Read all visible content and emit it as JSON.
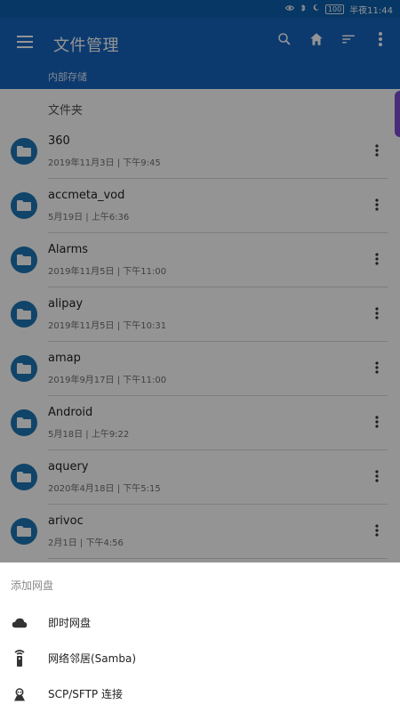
{
  "status_bar": {
    "battery": "100",
    "time": "半夜11:44",
    "icons": [
      "eye-icon",
      "bluetooth-icon",
      "moon-icon"
    ]
  },
  "app_bar": {
    "title": "文件管理",
    "breadcrumb": "内部存储",
    "actions": [
      "search-icon",
      "home-icon",
      "sort-icon",
      "more-vertical-icon"
    ],
    "color": "#1565c0"
  },
  "main": {
    "section_title": "文件夹",
    "items": [
      {
        "name": "360",
        "meta": "2019年11月3日 | 下午9:45"
      },
      {
        "name": "accmeta_vod",
        "meta": "5月19日 | 上午6:36"
      },
      {
        "name": "Alarms",
        "meta": "2019年11月5日 | 下午11:00"
      },
      {
        "name": "alipay",
        "meta": "2019年11月5日 | 下午10:31"
      },
      {
        "name": "amap",
        "meta": "2019年9月17日 | 下午11:00"
      },
      {
        "name": "Android",
        "meta": "5月18日 | 上午9:22"
      },
      {
        "name": "aquery",
        "meta": "2020年4月18日 | 下午5:15"
      },
      {
        "name": "arivoc",
        "meta": "2月1日 | 下午4:56"
      }
    ]
  },
  "bottom_sheet": {
    "title": "添加网盘",
    "options": [
      {
        "label": "即时网盘",
        "icon": "cloud-icon"
      },
      {
        "label": "网络邻居(Samba)",
        "icon": "network-remote-icon"
      },
      {
        "label": "SCP/SFTP 连接",
        "icon": "scp-sftp-icon"
      }
    ]
  }
}
